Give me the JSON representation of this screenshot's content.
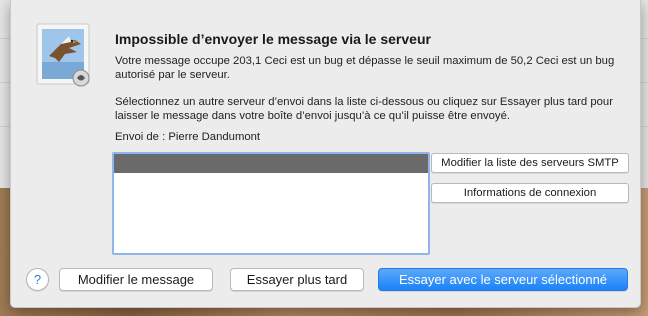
{
  "dialog": {
    "title": "Impossible d’envoyer le message via le serveur",
    "message": "Votre message occupe 203,1 Ceci est un bug et dépasse le seuil maximum de 50,2 Ceci est un bug autorisé par le serveur.",
    "instructions": "Sélectionnez un autre serveur d’envoi dans la liste ci-dessous ou cliquez sur Essayer plus tard pour laisser le message dans votre boîte d’envoi jusqu’à ce qu’il puisse être envoyé.",
    "from_line": "Envoi de : Pierre Dandumont",
    "app_icon": "mail-stamp-icon"
  },
  "server_list": {
    "selected_index": 0,
    "items": [
      ""
    ]
  },
  "side_buttons": {
    "edit_smtp_list": "Modifier la liste des serveurs SMTP",
    "connection_info": "Informations de connexion"
  },
  "footer": {
    "help": "?",
    "edit_message": "Modifier le message",
    "try_later": "Essayer plus tard",
    "try_selected": "Essayer avec le serveur sélectionné"
  },
  "colors": {
    "accent": "#1a82f7",
    "selection": "#6a6a6a",
    "focus_ring": "#8fb6ea"
  }
}
